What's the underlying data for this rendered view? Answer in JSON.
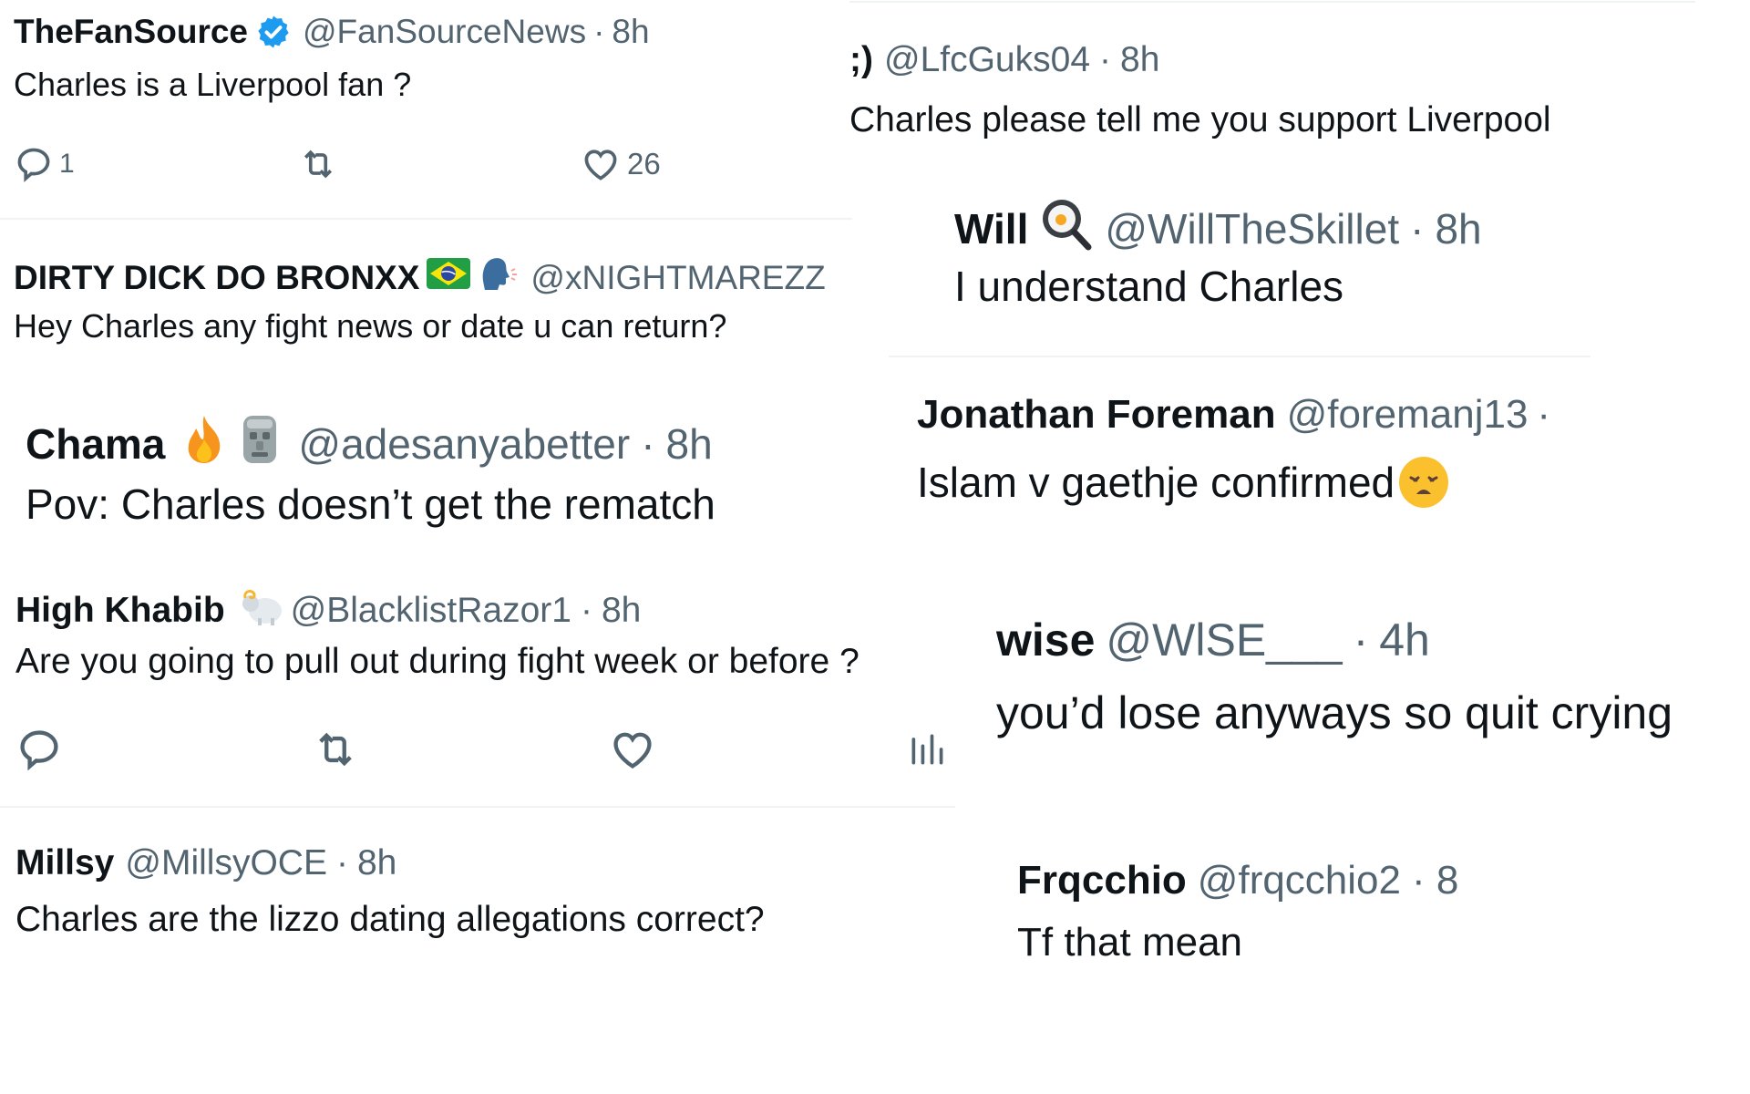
{
  "tweets": [
    {
      "name": "TheFanSource",
      "verified": true,
      "handle": "@FanSourceNews",
      "time": "8h",
      "text": "Charles is a Liverpool fan ?",
      "reply_count": "1",
      "like_count": "26"
    },
    {
      "name": "DIRTY DICK DO BRONXX",
      "emojis": [
        "brazil-flag",
        "speaking-head"
      ],
      "handle": "@xNIGHTMAREZZ",
      "text": "Hey Charles any fight news or date u can return?"
    },
    {
      "name": "Chama",
      "emojis": [
        "fire",
        "moai"
      ],
      "handle": "@adesanyabetter",
      "time": "8h",
      "text": "Pov: Charles doesn’t get the rematch"
    },
    {
      "name": "High Khabib",
      "emojis": [
        "ram"
      ],
      "handle": "@BlacklistRazor1",
      "time": "8h",
      "text": "Are you going to pull out during fight week or before ?"
    },
    {
      "name": "Millsy",
      "handle": "@MillsyOCE",
      "time": "8h",
      "text": "Charles are the lizzo dating allegations correct?"
    },
    {
      "name": ";)",
      "handle": "@LfcGuks04",
      "time": "8h",
      "text": "Charles please tell me you support Liverpool"
    },
    {
      "name": "Will",
      "emojis": [
        "frying-pan-egg"
      ],
      "handle": "@WillTheSkillet",
      "time": "8h",
      "text": "I understand Charles"
    },
    {
      "name": "Jonathan Foreman",
      "handle": "@foremanj13",
      "time_partial": "·",
      "text": "Islam v gaethje confirmed",
      "trailing_emoji": "tired-face"
    },
    {
      "name": "wise",
      "handle": "@WlSE___",
      "time": "4h",
      "text": "you’d lose anyways so quit crying"
    },
    {
      "name": "Frqcchio",
      "handle": "@frqcchio2",
      "time_partial": "· 8",
      "text": "Tf that mean"
    }
  ],
  "separator": "·",
  "colors": {
    "text_primary": "#0f1419",
    "text_secondary": "#536471",
    "verified_blue": "#1d9bf0",
    "divider": "#eff3f4"
  }
}
